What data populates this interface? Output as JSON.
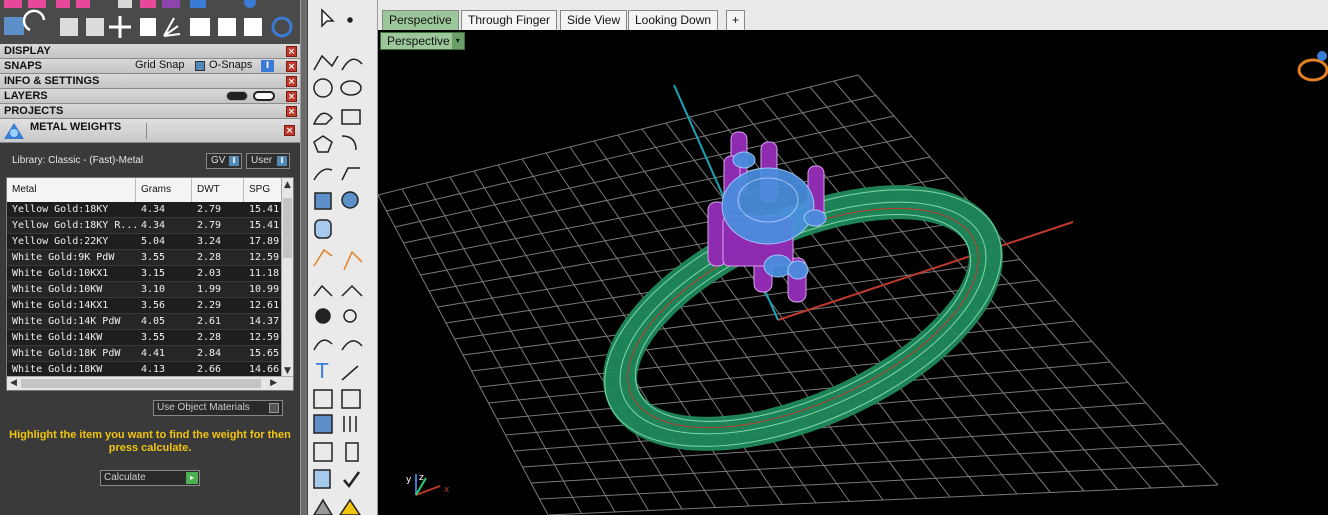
{
  "panels": {
    "display": "DISPLAY",
    "snaps": "SNAPS",
    "grid_snap": "Grid Snap",
    "o_snaps": "O-Snaps",
    "info_settings": "INFO & SETTINGS",
    "layers": "LAYERS",
    "projects": "PROJECTS",
    "close_glyph": "×"
  },
  "metal_weights": {
    "title": "METAL WEIGHTS",
    "library": "Library: Classic - (Fast)-Metal",
    "gv": "GV",
    "user": "User",
    "toggle_mark": "I",
    "columns": [
      "Metal",
      "Grams",
      "DWT",
      "SPG"
    ],
    "rows": [
      [
        "Yellow Gold:18KY",
        "4.34",
        "2.79",
        "15.41"
      ],
      [
        "Yellow Gold:18KY R...",
        "4.34",
        "2.79",
        "15.41"
      ],
      [
        "Yellow Gold:22KY",
        "5.04",
        "3.24",
        "17.89"
      ],
      [
        "White Gold:9K PdW",
        "3.55",
        "2.28",
        "12.59"
      ],
      [
        "White Gold:10KX1",
        "3.15",
        "2.03",
        "11.18"
      ],
      [
        "White Gold:10KW",
        "3.10",
        "1.99",
        "10.99"
      ],
      [
        "White Gold:14KX1",
        "3.56",
        "2.29",
        "12.61"
      ],
      [
        "White Gold:14K PdW",
        "4.05",
        "2.61",
        "14.37"
      ],
      [
        "White Gold:14KW",
        "3.55",
        "2.28",
        "12.59"
      ],
      [
        "White Gold:18K PdW",
        "4.41",
        "2.84",
        "15.65"
      ],
      [
        "White Gold:18KW",
        "4.13",
        "2.66",
        "14.66"
      ]
    ],
    "use_object_materials": "Use Object Materials",
    "hint": "Highlight the item you want to find the weight for then press calculate.",
    "calculate": "Calculate",
    "go_glyph": "▸"
  },
  "tabs": [
    "Perspective",
    "Through Finger",
    "Side View",
    "Looking Down",
    "+"
  ],
  "viewport": {
    "label": "Perspective",
    "dropdown_glyph": "▾",
    "axis_x": "x",
    "axis_y": "y",
    "axis_z": "z"
  },
  "colors": {
    "ring_band": "#1f8a5c",
    "prongs": "#8e2bb0",
    "gem": "#4a8fe0",
    "grid": "#7a7a7a",
    "axis_red": "#c0392b",
    "axis_cyan": "#1aa6b7",
    "hint_text": "#f1c40f",
    "active_tab": "#9cc79a"
  },
  "icons": {
    "toolbox": [
      "pointer-icon",
      "point-icon",
      "polyline-icon",
      "curve-edit-icon",
      "circle-icon",
      "ellipse-icon",
      "arc-icon",
      "rectangle-icon",
      "polygon-icon",
      "fillet-icon",
      "offset-icon",
      "sweep-icon",
      "box-icon",
      "sphere-icon",
      "cylinder-icon",
      "surface-icon",
      "transform-icon",
      "boolean-icon",
      "rail-icon",
      "split-icon",
      "gem-icon",
      "pearl-icon",
      "bend-icon",
      "twist-icon",
      "text-icon",
      "scale-icon",
      "array-icon",
      "mirror-icon",
      "solid-icon",
      "prong-icon",
      "grid-icon",
      "measure-icon",
      "extrude-icon",
      "check-icon",
      "pyramid-icon",
      "lock-icon"
    ]
  }
}
